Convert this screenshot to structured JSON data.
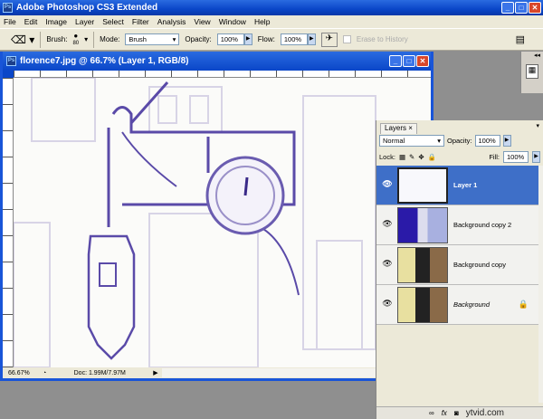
{
  "app": {
    "title": "Adobe Photoshop CS3 Extended",
    "icon": "ps-logo-icon"
  },
  "menu": [
    "File",
    "Edit",
    "Image",
    "Layer",
    "Select",
    "Filter",
    "Analysis",
    "View",
    "Window",
    "Help"
  ],
  "options": {
    "brush_label": "Brush:",
    "brush_size": "80",
    "mode_label": "Mode:",
    "mode_value": "Brush",
    "opacity_label": "Opacity:",
    "opacity_value": "100%",
    "flow_label": "Flow:",
    "flow_value": "100%",
    "erase_history": "Erase to History"
  },
  "document": {
    "title": "florence7.jpg @ 66.7% (Layer 1, RGB/8)",
    "zoom": "66.67%",
    "doc_size": "Doc: 1.99M/7.97M"
  },
  "layers_panel": {
    "tab": "Layers",
    "blend_mode": "Normal",
    "opacity_label": "Opacity:",
    "opacity_value": "100%",
    "lock_label": "Lock:",
    "fill_label": "Fill:",
    "fill_value": "100%",
    "layers": [
      {
        "name": "Layer 1",
        "selected": true
      },
      {
        "name": "Background copy 2"
      },
      {
        "name": "Background copy"
      },
      {
        "name": "Background",
        "locked": true
      }
    ],
    "footer_icons": [
      "link-icon",
      "fx-icon",
      "mask-icon",
      "adjustment-icon",
      "new-layer-icon",
      "trash-icon"
    ]
  },
  "watermark": "ytvid.com"
}
